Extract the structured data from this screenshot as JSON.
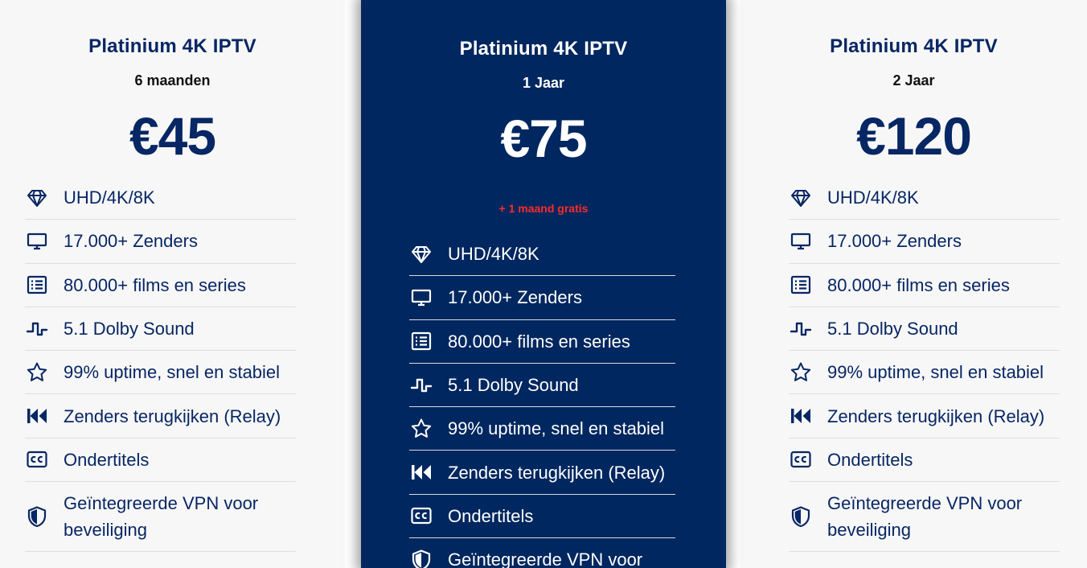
{
  "colors": {
    "navy": "#00275f",
    "title_navy": "#072664",
    "promo_red": "#ff2a2a",
    "light_card_bg": "#f7f7f7"
  },
  "plans": [
    {
      "title": "Platinium 4K IPTV",
      "duration": "6 maanden",
      "price": "€45",
      "promo": "",
      "features": [
        {
          "icon": "diamond-icon",
          "text": "UHD/4K/8K"
        },
        {
          "icon": "monitor-icon",
          "text": "17.000+ Zenders"
        },
        {
          "icon": "list-icon",
          "text": "80.000+ films en series"
        },
        {
          "icon": "sound-wave-icon",
          "text": "5.1 Dolby Sound"
        },
        {
          "icon": "star-icon",
          "text": "99% uptime, snel en stabiel"
        },
        {
          "icon": "fast-backward-icon",
          "text": "Zenders terugkijken (Relay)"
        },
        {
          "icon": "closed-captions-icon",
          "text": "Ondertitels"
        },
        {
          "icon": "shield-icon",
          "text": "Geïntegreerde VPN voor beveiliging"
        }
      ]
    },
    {
      "title": "Platinium 4K IPTV",
      "duration": "1 Jaar",
      "price": "€75",
      "promo": "+ 1 maand gratis",
      "features": [
        {
          "icon": "diamond-icon",
          "text": "UHD/4K/8K"
        },
        {
          "icon": "monitor-icon",
          "text": "17.000+ Zenders"
        },
        {
          "icon": "list-icon",
          "text": "80.000+ films en series"
        },
        {
          "icon": "sound-wave-icon",
          "text": "5.1 Dolby Sound"
        },
        {
          "icon": "star-icon",
          "text": "99% uptime, snel en stabiel"
        },
        {
          "icon": "fast-backward-icon",
          "text": "Zenders terugkijken (Relay)"
        },
        {
          "icon": "closed-captions-icon",
          "text": "Ondertitels"
        },
        {
          "icon": "shield-icon",
          "text": "Geïntegreerde VPN voor"
        }
      ]
    },
    {
      "title": "Platinium 4K IPTV",
      "duration": "2 Jaar",
      "price": "€120",
      "promo": "",
      "features": [
        {
          "icon": "diamond-icon",
          "text": "UHD/4K/8K"
        },
        {
          "icon": "monitor-icon",
          "text": "17.000+ Zenders"
        },
        {
          "icon": "list-icon",
          "text": "80.000+ films en series"
        },
        {
          "icon": "sound-wave-icon",
          "text": "5.1 Dolby Sound"
        },
        {
          "icon": "star-icon",
          "text": "99% uptime, snel en stabiel"
        },
        {
          "icon": "fast-backward-icon",
          "text": "Zenders terugkijken (Relay)"
        },
        {
          "icon": "closed-captions-icon",
          "text": "Ondertitels"
        },
        {
          "icon": "shield-icon",
          "text": "Geïntegreerde VPN voor beveiliging"
        }
      ]
    }
  ]
}
